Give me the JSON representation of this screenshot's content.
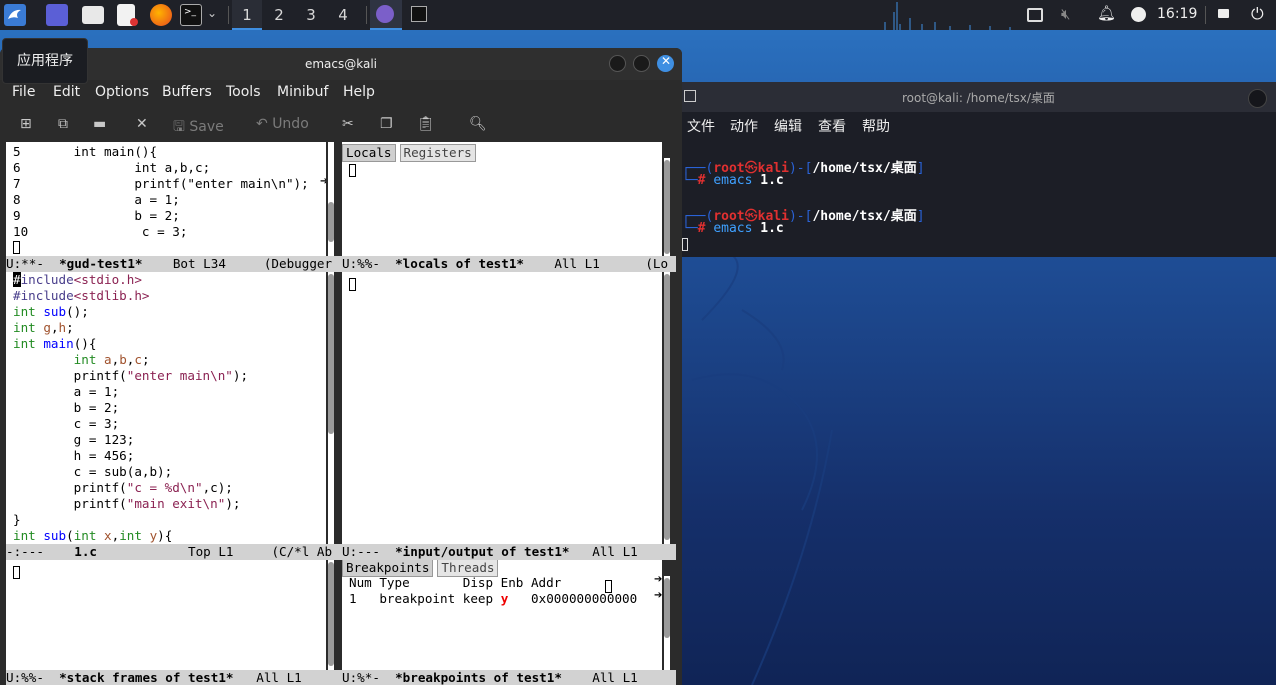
{
  "taskbar": {
    "workspaces": [
      "1",
      "2",
      "3",
      "4"
    ],
    "clock": "16:19",
    "icons": [
      "kali-menu-icon",
      "desktop-icon",
      "file-manager-icon",
      "text-editor-icon",
      "firefox-icon",
      "terminal-icon",
      "emacs-icon",
      "terminal-icon"
    ]
  },
  "tooltip": {
    "text": "应用程序"
  },
  "emacs": {
    "title": "emacs@kali",
    "menu": [
      "File",
      "Edit",
      "Options",
      "Buffers",
      "Tools",
      "Minibuf",
      "Help"
    ],
    "toolbar": {
      "save": "Save",
      "undo": "Undo"
    },
    "gud": {
      "lines": [
        "5",
        "6",
        "7",
        "8",
        "9",
        "10"
      ],
      "code": [
        "       int main(){",
        "               int a,b,c;",
        "               printf(\"enter main\\n\");",
        "               a = 1;",
        "               b = 2;",
        "               c = 3;"
      ],
      "modeline": {
        "status": "U:**-",
        "buffer": "*gud-test1*",
        "pos": "Bot L34",
        "mode": "(Debugger"
      }
    },
    "locals": {
      "tabs": [
        "Locals",
        "Registers"
      ],
      "modeline": {
        "status": "U:%%-",
        "buffer": "*locals of test1*",
        "pos": "All L1",
        "mode": "(Lo"
      }
    },
    "source": {
      "modeline": {
        "status": "-:---",
        "buffer": "1.c",
        "pos": "Top L1",
        "mode": "(C/*l Ab"
      }
    },
    "io": {
      "modeline": {
        "status": "U:---",
        "buffer": "*input/output of test1*",
        "pos": "All L1"
      }
    },
    "stack": {
      "modeline": {
        "status": "U:%%-",
        "buffer": "*stack frames of test1*",
        "pos": "All L1"
      }
    },
    "breakpoints": {
      "tabs": [
        "Breakpoints",
        "Threads"
      ],
      "header": "Num Type       Disp Enb Addr",
      "row": {
        "num": "1",
        "type": "breakpoint",
        "disp": "keep",
        "enb": "y",
        "addr": "0x000000000000"
      },
      "modeline": {
        "status": "U:%*-",
        "buffer": "*breakpoints of test1*",
        "pos": "All L1"
      }
    }
  },
  "terminal": {
    "title": "root@kali: /home/tsx/桌面",
    "menu": [
      "文件",
      "动作",
      "编辑",
      "查看",
      "帮助"
    ],
    "prompts": [
      {
        "user": "root",
        "sym": "㉿",
        "host": "kali",
        "path": "/home/tsx/桌面",
        "cmd": "emacs",
        "arg": "1.c"
      },
      {
        "user": "root",
        "sym": "㉿",
        "host": "kali",
        "path": "/home/tsx/桌面",
        "cmd": "emacs",
        "arg": "1.c"
      }
    ]
  }
}
